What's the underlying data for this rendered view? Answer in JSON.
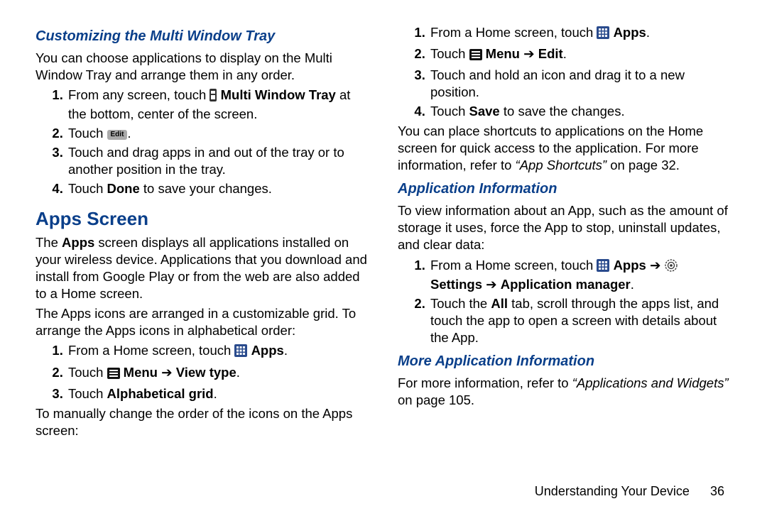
{
  "left": {
    "h_customize": "Customizing the Multi Window Tray",
    "p_customize_intro": "You can choose applications to display on the Multi Window Tray and arrange them in any order.",
    "steps_customize": {
      "s1_a": "From any screen, touch ",
      "s1_b": " Multi Window Tray",
      "s1_c": " at the bottom, center of the screen.",
      "s2_a": "Touch ",
      "s2_icon": "Edit",
      "s2_b": ".",
      "s3": "Touch and drag apps in and out of the tray or to another position in the tray.",
      "s4_a": "Touch ",
      "s4_b": "Done",
      "s4_c": " to save your changes."
    },
    "h_apps": "Apps Screen",
    "p_apps_1_a": "The ",
    "p_apps_1_b": "Apps",
    "p_apps_1_c": " screen displays all applications installed on your wireless device. Applications that you download and install from Google Play or from the web are also added to a Home screen.",
    "p_apps_2": "The Apps icons are arranged in a customizable grid. To arrange the Apps icons in alphabetical order:",
    "steps_alpha": {
      "s1_a": "From a Home screen, touch ",
      "s1_b": "Apps",
      "s1_c": ".",
      "s2_a": "Touch ",
      "s2_menu": "Menu",
      "s2_arrow": " ➔ ",
      "s2_view": "View type",
      "s2_c": ".",
      "s3_a": "Touch ",
      "s3_b": "Alphabetical grid",
      "s3_c": "."
    },
    "p_manual": "To manually change the order of the icons on the Apps screen:"
  },
  "right": {
    "steps_manual": {
      "s1_a": "From a Home screen, touch ",
      "s1_b": "Apps",
      "s1_c": ".",
      "s2_a": "Touch ",
      "s2_menu": "Menu",
      "s2_arrow": " ➔ ",
      "s2_edit": "Edit",
      "s2_c": ".",
      "s3": "Touch and hold an icon and drag it to a new position.",
      "s4_a": "Touch ",
      "s4_b": "Save",
      "s4_c": " to save the changes."
    },
    "p_shortcuts_a": "You can place shortcuts to applications on the Home screen for quick access to the application. For more information, refer to ",
    "p_shortcuts_q": "“App Shortcuts”",
    "p_shortcuts_b": " on page 32.",
    "h_appinfo": "Application Information",
    "p_appinfo_intro": "To view information about an App, such as the amount of storage it uses, force the App to stop, uninstall updates, and clear data:",
    "steps_appinfo": {
      "s1_a": "From a Home screen, touch ",
      "s1_apps": "Apps",
      "s1_arr1": " ➔ ",
      "s1_settings": "Settings",
      "s1_arr2": " ➔ ",
      "s1_mgr": "Application manager",
      "s1_c": ".",
      "s2_a": "Touch the ",
      "s2_b": "All",
      "s2_c": " tab, scroll through the apps list, and touch the app to open a screen with details about the App."
    },
    "h_more": "More Application Information",
    "p_more_a": "For more information, refer to ",
    "p_more_q": "“Applications and Widgets”",
    "p_more_b": " on page 105."
  },
  "footer": {
    "section": "Understanding Your Device",
    "page": "36"
  }
}
